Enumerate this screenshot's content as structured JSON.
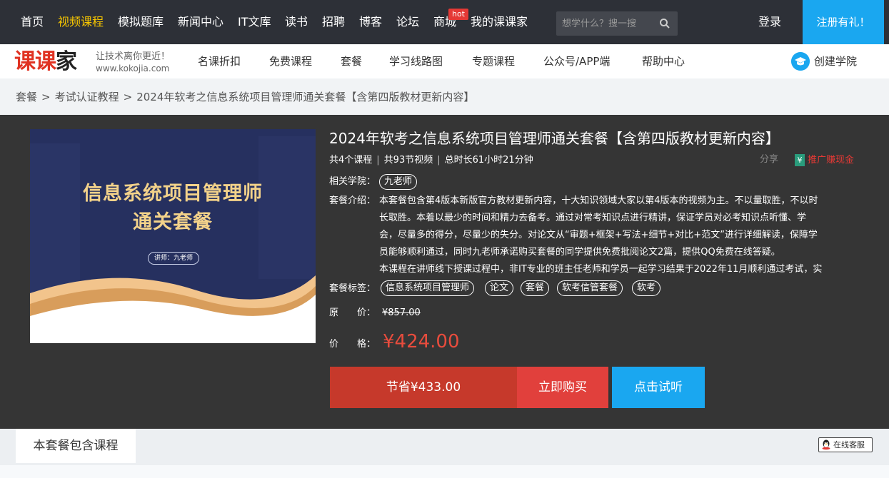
{
  "topnav": {
    "items": [
      "首页",
      "视频课程",
      "模拟题库",
      "新闻中心",
      "IT文库",
      "读书",
      "招聘",
      "博客",
      "论坛",
      "商城",
      "我的课课家"
    ],
    "hot_badge": "hot",
    "search_placeholder": "想学什么？搜一搜",
    "login": "登录",
    "register": "注册有礼！"
  },
  "subnav": {
    "logo_text_a": "课课",
    "logo_text_b": "家",
    "logo_slogan": "让技术离你更近！",
    "logo_url": "www.kokojia.com",
    "items": [
      "名课折扣",
      "免费课程",
      "套餐",
      "学习线路图",
      "专题课程",
      "公众号/APP端",
      "帮助中心"
    ],
    "college": "创建学院"
  },
  "breadcrumb": [
    "套餐",
    "考试认证教程",
    "2024年软考之信息系统项目管理师通关套餐【含第四版教材更新内容】"
  ],
  "course": {
    "cover": {
      "title_line1": "信息系统项目管理师",
      "title_line2": "通关套餐",
      "teacher": "讲师：九老师"
    },
    "title": "2024年软考之信息系统项目管理师通关套餐【含第四版教材更新内容】",
    "meta": [
      "共4个课程",
      "共93节视频",
      "总时长61小时21分钟"
    ],
    "share": "分享",
    "promo_icon": "¥",
    "promo": "推广赚现金",
    "college_label": "相关学院：",
    "college_tag": "九老师",
    "intro_label": "套餐介绍：",
    "intro_lines": [
      "本套餐包含第4版本新版官方教材更新内容，十大知识领域大家以第4版本的视频为主。不以量取胜，不以时",
      "长取胜。本着以最少的时间和精力去备考。通过对常考知识点进行精讲，保证学员对必考知识点听懂、学",
      "会，尽量多的得分，尽量少的失分。对论文从“审题+框架+写法+细节+对比+范文”进行详细解读，保障学",
      "员能够顺利通过，同时九老师承诺购买套餐的同学提供免费批阅论文2篇，提供QQ免费在线答疑。",
      "本课程在讲师线下授课过程中，非IT专业的班主任老师和学员一起学习结果于2022年11月顺利通过考试，实"
    ],
    "tags_label": "套餐标签：",
    "tags": [
      "信息系统项目管理师",
      "论文",
      "套餐",
      "软考信管套餐",
      "软考"
    ],
    "orig_label": "原　　价：",
    "orig_price": "¥857.00",
    "price_label": "价　　格：",
    "price": "¥424.00",
    "save_btn": "节省¥433.00",
    "buy_btn": "立即购买",
    "trial_btn": "点击试听"
  },
  "bottom": {
    "tab": "本套餐包含课程",
    "service": "在线客服"
  },
  "colors": {
    "accent_blue": "#1aa7f0",
    "price_red": "#e84c3d",
    "nav_active": "#f7c600"
  }
}
